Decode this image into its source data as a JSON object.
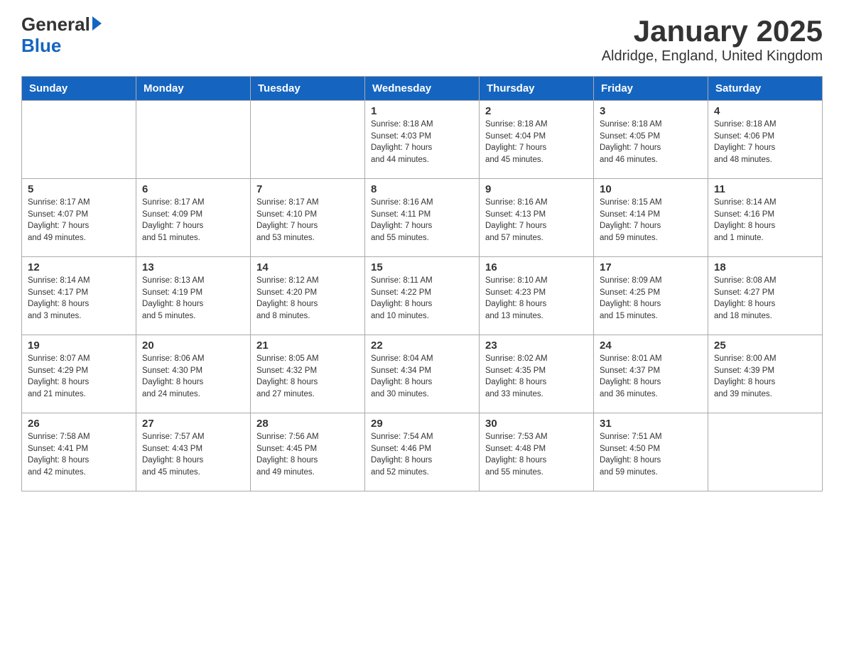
{
  "header": {
    "logo_general": "General",
    "logo_blue": "Blue",
    "title": "January 2025",
    "subtitle": "Aldridge, England, United Kingdom"
  },
  "calendar": {
    "headers": [
      "Sunday",
      "Monday",
      "Tuesday",
      "Wednesday",
      "Thursday",
      "Friday",
      "Saturday"
    ],
    "rows": [
      [
        {
          "day": "",
          "info": ""
        },
        {
          "day": "",
          "info": ""
        },
        {
          "day": "",
          "info": ""
        },
        {
          "day": "1",
          "info": "Sunrise: 8:18 AM\nSunset: 4:03 PM\nDaylight: 7 hours\nand 44 minutes."
        },
        {
          "day": "2",
          "info": "Sunrise: 8:18 AM\nSunset: 4:04 PM\nDaylight: 7 hours\nand 45 minutes."
        },
        {
          "day": "3",
          "info": "Sunrise: 8:18 AM\nSunset: 4:05 PM\nDaylight: 7 hours\nand 46 minutes."
        },
        {
          "day": "4",
          "info": "Sunrise: 8:18 AM\nSunset: 4:06 PM\nDaylight: 7 hours\nand 48 minutes."
        }
      ],
      [
        {
          "day": "5",
          "info": "Sunrise: 8:17 AM\nSunset: 4:07 PM\nDaylight: 7 hours\nand 49 minutes."
        },
        {
          "day": "6",
          "info": "Sunrise: 8:17 AM\nSunset: 4:09 PM\nDaylight: 7 hours\nand 51 minutes."
        },
        {
          "day": "7",
          "info": "Sunrise: 8:17 AM\nSunset: 4:10 PM\nDaylight: 7 hours\nand 53 minutes."
        },
        {
          "day": "8",
          "info": "Sunrise: 8:16 AM\nSunset: 4:11 PM\nDaylight: 7 hours\nand 55 minutes."
        },
        {
          "day": "9",
          "info": "Sunrise: 8:16 AM\nSunset: 4:13 PM\nDaylight: 7 hours\nand 57 minutes."
        },
        {
          "day": "10",
          "info": "Sunrise: 8:15 AM\nSunset: 4:14 PM\nDaylight: 7 hours\nand 59 minutes."
        },
        {
          "day": "11",
          "info": "Sunrise: 8:14 AM\nSunset: 4:16 PM\nDaylight: 8 hours\nand 1 minute."
        }
      ],
      [
        {
          "day": "12",
          "info": "Sunrise: 8:14 AM\nSunset: 4:17 PM\nDaylight: 8 hours\nand 3 minutes."
        },
        {
          "day": "13",
          "info": "Sunrise: 8:13 AM\nSunset: 4:19 PM\nDaylight: 8 hours\nand 5 minutes."
        },
        {
          "day": "14",
          "info": "Sunrise: 8:12 AM\nSunset: 4:20 PM\nDaylight: 8 hours\nand 8 minutes."
        },
        {
          "day": "15",
          "info": "Sunrise: 8:11 AM\nSunset: 4:22 PM\nDaylight: 8 hours\nand 10 minutes."
        },
        {
          "day": "16",
          "info": "Sunrise: 8:10 AM\nSunset: 4:23 PM\nDaylight: 8 hours\nand 13 minutes."
        },
        {
          "day": "17",
          "info": "Sunrise: 8:09 AM\nSunset: 4:25 PM\nDaylight: 8 hours\nand 15 minutes."
        },
        {
          "day": "18",
          "info": "Sunrise: 8:08 AM\nSunset: 4:27 PM\nDaylight: 8 hours\nand 18 minutes."
        }
      ],
      [
        {
          "day": "19",
          "info": "Sunrise: 8:07 AM\nSunset: 4:29 PM\nDaylight: 8 hours\nand 21 minutes."
        },
        {
          "day": "20",
          "info": "Sunrise: 8:06 AM\nSunset: 4:30 PM\nDaylight: 8 hours\nand 24 minutes."
        },
        {
          "day": "21",
          "info": "Sunrise: 8:05 AM\nSunset: 4:32 PM\nDaylight: 8 hours\nand 27 minutes."
        },
        {
          "day": "22",
          "info": "Sunrise: 8:04 AM\nSunset: 4:34 PM\nDaylight: 8 hours\nand 30 minutes."
        },
        {
          "day": "23",
          "info": "Sunrise: 8:02 AM\nSunset: 4:35 PM\nDaylight: 8 hours\nand 33 minutes."
        },
        {
          "day": "24",
          "info": "Sunrise: 8:01 AM\nSunset: 4:37 PM\nDaylight: 8 hours\nand 36 minutes."
        },
        {
          "day": "25",
          "info": "Sunrise: 8:00 AM\nSunset: 4:39 PM\nDaylight: 8 hours\nand 39 minutes."
        }
      ],
      [
        {
          "day": "26",
          "info": "Sunrise: 7:58 AM\nSunset: 4:41 PM\nDaylight: 8 hours\nand 42 minutes."
        },
        {
          "day": "27",
          "info": "Sunrise: 7:57 AM\nSunset: 4:43 PM\nDaylight: 8 hours\nand 45 minutes."
        },
        {
          "day": "28",
          "info": "Sunrise: 7:56 AM\nSunset: 4:45 PM\nDaylight: 8 hours\nand 49 minutes."
        },
        {
          "day": "29",
          "info": "Sunrise: 7:54 AM\nSunset: 4:46 PM\nDaylight: 8 hours\nand 52 minutes."
        },
        {
          "day": "30",
          "info": "Sunrise: 7:53 AM\nSunset: 4:48 PM\nDaylight: 8 hours\nand 55 minutes."
        },
        {
          "day": "31",
          "info": "Sunrise: 7:51 AM\nSunset: 4:50 PM\nDaylight: 8 hours\nand 59 minutes."
        },
        {
          "day": "",
          "info": ""
        }
      ]
    ]
  }
}
